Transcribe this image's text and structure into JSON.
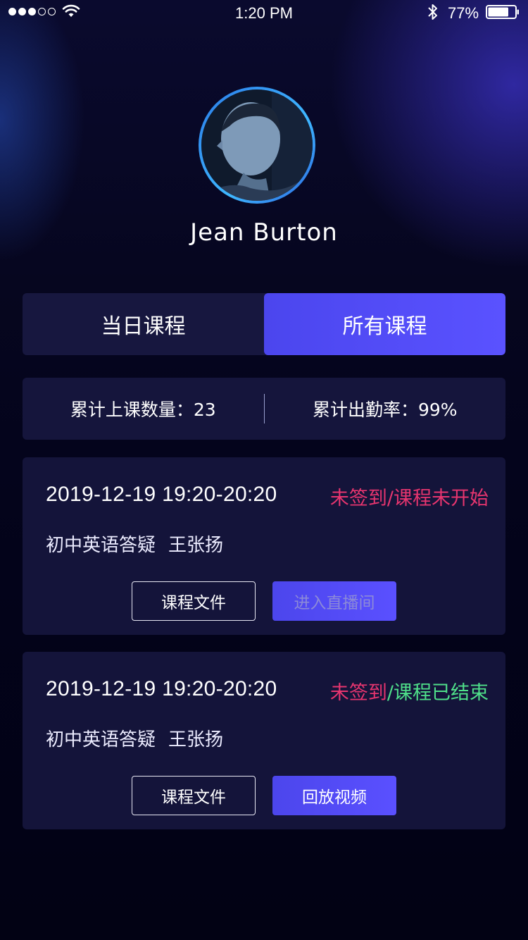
{
  "status_bar": {
    "time": "1:20 PM",
    "battery_percent": "77%",
    "battery_level": 0.77,
    "signal_bars": 3,
    "signal_total": 5
  },
  "profile": {
    "name": "Jean Burton"
  },
  "tabs": [
    {
      "label": "当日课程",
      "active": false
    },
    {
      "label": "所有课程",
      "active": true
    }
  ],
  "stats": {
    "count_label": "累计上课数量：",
    "count_value": "23",
    "rate_label": "累计出勤率：",
    "rate_value": "99%"
  },
  "courses": [
    {
      "time": "2019-12-19 19:20-20:20",
      "status_checkin": "未签到",
      "status_sep": "/",
      "status_course": "课程未开始",
      "course_status_color": "#e7356f",
      "title": "初中英语答疑",
      "teacher": "王张扬",
      "file_button": "课程文件",
      "action_button": "进入直播间",
      "action_disabled": true
    },
    {
      "time": "2019-12-19 19:20-20:20",
      "status_checkin": "未签到",
      "status_sep": "/",
      "status_course": "课程已结束",
      "course_status_color": "#4fe08a",
      "title": "初中英语答疑",
      "teacher": "王张扬",
      "file_button": "课程文件",
      "action_button": "回放视频",
      "action_disabled": false
    }
  ],
  "colors": {
    "accent": "#5a52ff",
    "status_pink": "#e7356f",
    "status_green": "#4fe08a",
    "card_bg": "#14143a"
  },
  "icons": {
    "wifi": "wifi-icon",
    "bluetooth": "bluetooth-icon",
    "battery": "battery-icon"
  }
}
